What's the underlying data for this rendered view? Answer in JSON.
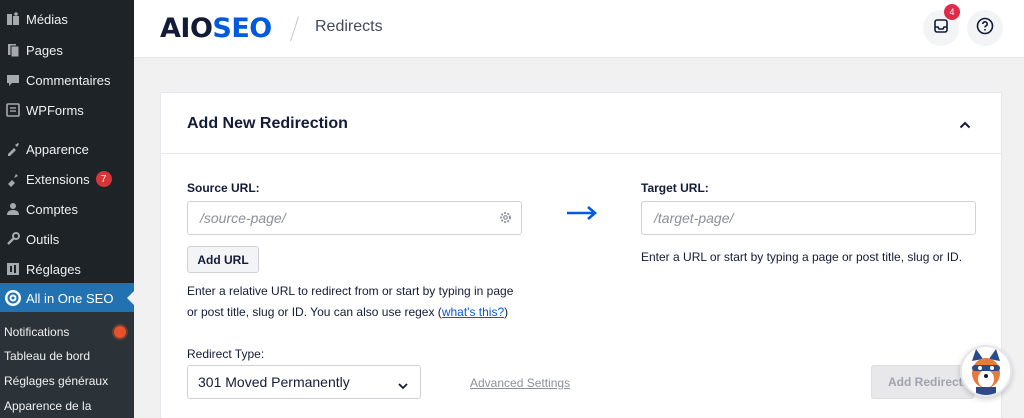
{
  "sidebar": {
    "items": [
      {
        "label": "Médias",
        "icon": "media-icon"
      },
      {
        "label": "Pages",
        "icon": "pages-icon"
      },
      {
        "label": "Commentaires",
        "icon": "comments-icon"
      },
      {
        "label": "WPForms",
        "icon": "wpforms-icon"
      },
      {
        "label": "Apparence",
        "icon": "appearance-icon"
      },
      {
        "label": "Extensions",
        "icon": "plugins-icon",
        "badge": "7"
      },
      {
        "label": "Comptes",
        "icon": "users-icon"
      },
      {
        "label": "Outils",
        "icon": "tools-icon"
      },
      {
        "label": "Réglages",
        "icon": "settings-icon"
      },
      {
        "label": "All in One SEO",
        "icon": "aioseo-icon"
      }
    ],
    "submenu": [
      {
        "label": "Notifications"
      },
      {
        "label": "Tableau de bord"
      },
      {
        "label": "Réglages généraux"
      },
      {
        "label": "Apparence de la"
      }
    ]
  },
  "header": {
    "logo_aio": "AIO",
    "logo_seo": "SEO",
    "breadcrumb": "Redirects",
    "notifications_count": "4"
  },
  "card": {
    "title": "Add New Redirection",
    "source_label": "Source URL:",
    "source_placeholder": "/source-page/",
    "add_url": "Add URL",
    "source_help_1": "Enter a relative URL to redirect from or start by typing in page",
    "source_help_2": "or post title, slug or ID. You can also use regex (",
    "source_help_link": "what's this?",
    "source_help_end": ")",
    "target_label": "Target URL:",
    "target_placeholder": "/target-page/",
    "target_help": "Enter a URL or start by typing a page or post title, slug or ID.",
    "redirect_type_label": "Redirect Type:",
    "redirect_type_value": "301 Moved Permanently",
    "advanced_settings": "Advanced Settings",
    "add_redirect": "Add Redirect"
  },
  "colors": {
    "wp_sidebar": "#1d2327",
    "wp_active": "#2271b1",
    "aioseo_blue": "#005ae0",
    "aioseo_dark": "#141b38"
  }
}
